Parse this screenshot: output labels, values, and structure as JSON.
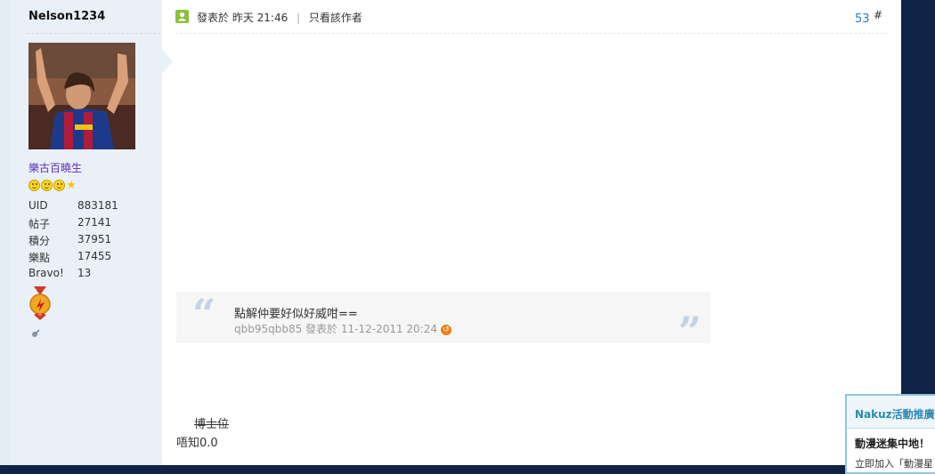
{
  "user": {
    "name": "Nelson1234",
    "group": "樂古百曉生",
    "stats": [
      {
        "label": "UID",
        "value": "883181"
      },
      {
        "label": "帖子",
        "value": "27141"
      },
      {
        "label": "積分",
        "value": "37951"
      },
      {
        "label": "樂點",
        "value": "17455"
      },
      {
        "label": "Bravo!",
        "value": "13"
      }
    ]
  },
  "post": {
    "posted_at": "發表於 昨天 21:46",
    "separator": "|",
    "author_only": "只看該作者",
    "floor": "53",
    "hash": "#"
  },
  "quote": {
    "text": "點解仲要好似好威咁==",
    "author_line": "qbb95qbb85 發表於 11-12-2011 20:24"
  },
  "body": {
    "struck_text": "博士位",
    "reply": "唔知0.0"
  },
  "promo": {
    "title": "Nakuz活動推廣",
    "subtitle": "動漫迷集中地！",
    "text": "立即加入「動漫星"
  },
  "colors": {
    "page_background": "#0f2347",
    "sidebar": "#e9f0f8",
    "group_text": "#5d2fb6",
    "floor_link": "#2a7cb8"
  }
}
